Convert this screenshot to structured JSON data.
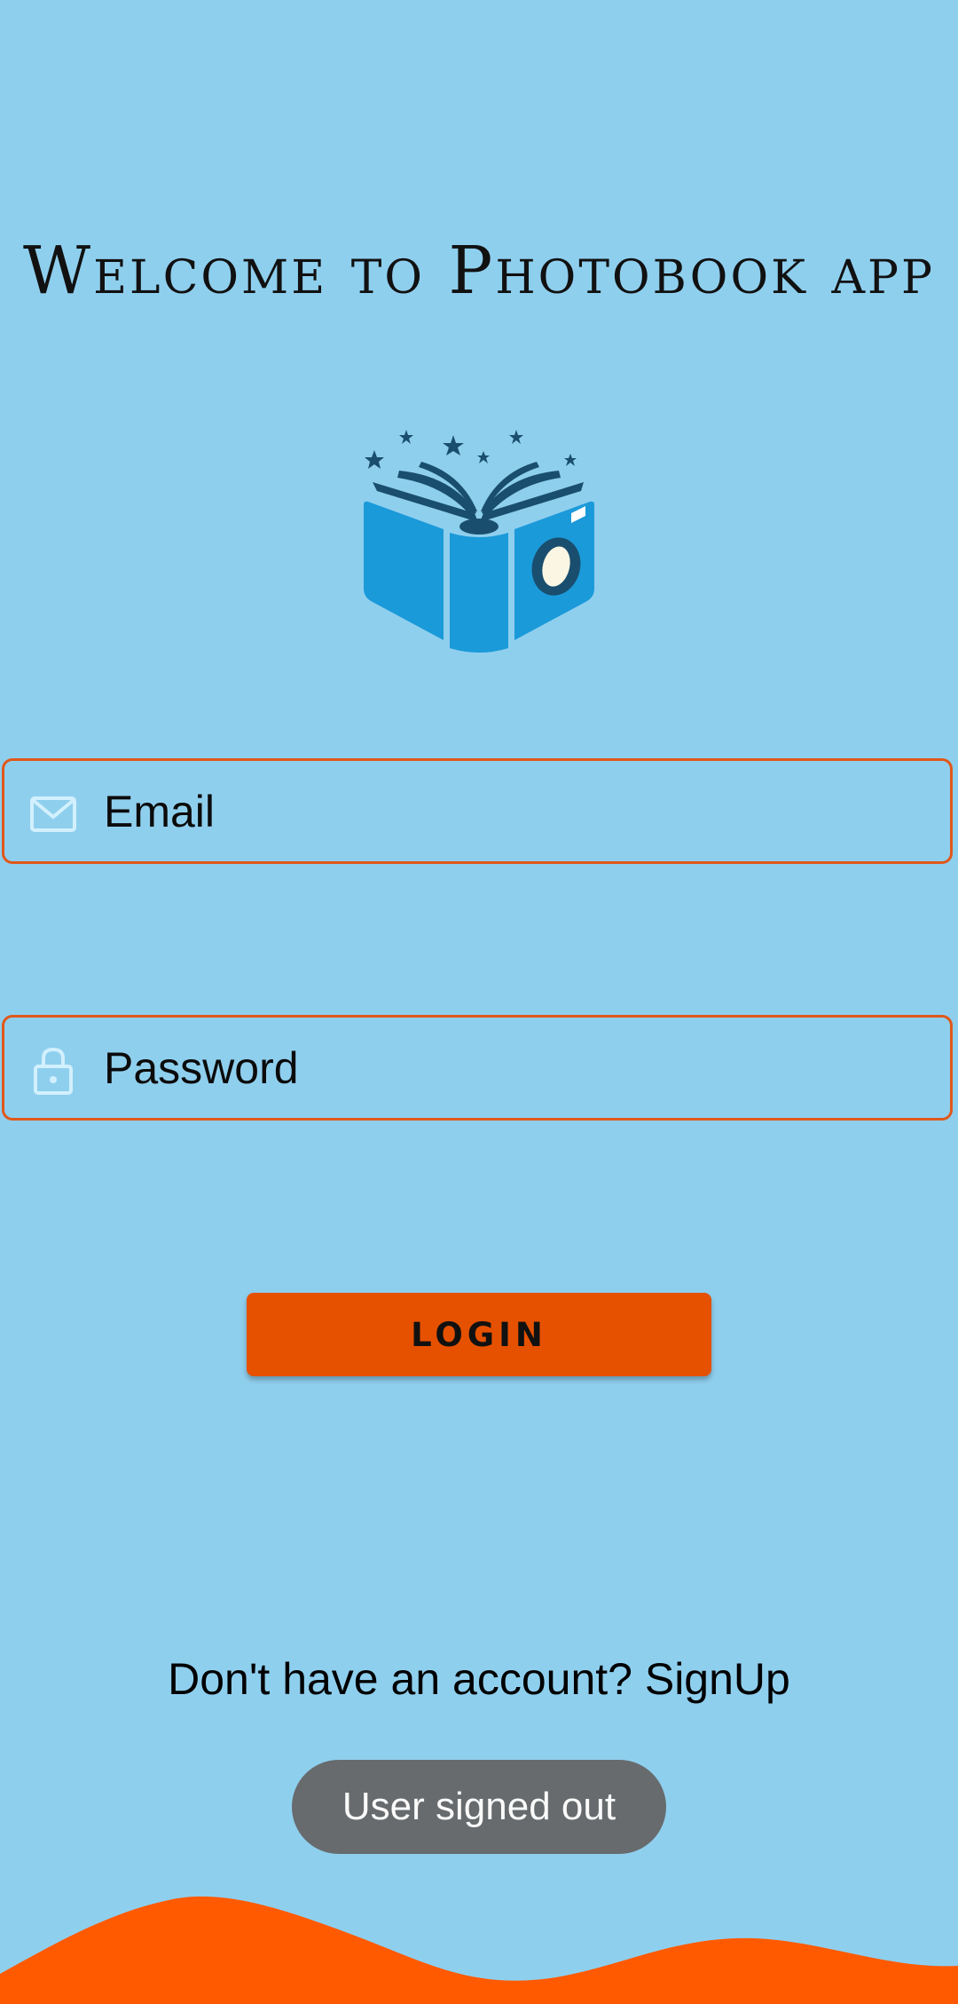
{
  "title": "Welcome to Photobook app",
  "logo": {
    "icon": "photobook-book-camera-logo"
  },
  "email_field": {
    "placeholder": "Email",
    "value": "",
    "icon": "mail-icon"
  },
  "password_field": {
    "placeholder": "Password",
    "value": "",
    "icon": "lock-icon"
  },
  "login_button": {
    "label": "LOGIN"
  },
  "signup": {
    "prompt": "Don't have an account? ",
    "link": "SignUp"
  },
  "toast": {
    "message": "User signed out"
  },
  "colors": {
    "background": "#8fcfee",
    "accent": "#e65100",
    "field_border": "#e0581a",
    "wave": "#ff5a00",
    "toast_bg": "#676b6d"
  }
}
